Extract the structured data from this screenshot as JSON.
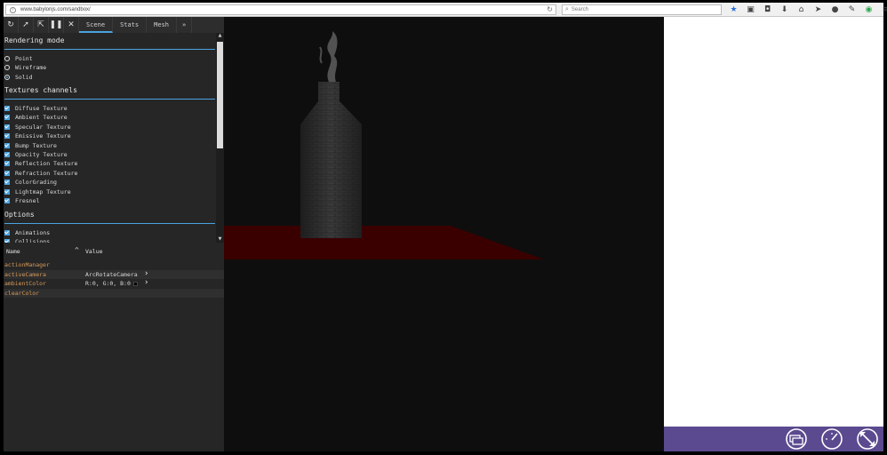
{
  "browser": {
    "url": "www.babylonjs.com/sandbox/",
    "search_placeholder": "Search",
    "toolbar_icons": [
      "star-icon",
      "clipboard-icon",
      "pocket-icon",
      "download-icon",
      "home-icon",
      "send-icon",
      "chat-icon",
      "pen-icon",
      "circle-icon",
      "menu-icon"
    ]
  },
  "inspector": {
    "tool_icons": [
      "refresh-icon",
      "pointer-icon",
      "popout-icon",
      "pause-icon",
      "close-icon"
    ],
    "tabs": [
      {
        "label": "Scene",
        "active": true
      },
      {
        "label": "Stats",
        "active": false
      },
      {
        "label": "Mesh",
        "active": false
      },
      {
        "label": "»",
        "active": false
      }
    ],
    "rendering_mode": {
      "title": "Rendering mode",
      "options": [
        {
          "label": "Point",
          "selected": false
        },
        {
          "label": "Wireframe",
          "selected": false
        },
        {
          "label": "Solid",
          "selected": true
        }
      ]
    },
    "textures": {
      "title": "Textures channels",
      "items": [
        "Diffuse Texture",
        "Ambient Texture",
        "Specular Texture",
        "Emissive Texture",
        "Bump Texture",
        "Opacity Texture",
        "Reflection Texture",
        "Refraction Texture",
        "ColorGrading",
        "Lightmap Texture",
        "Fresnel"
      ]
    },
    "options": {
      "title": "Options",
      "items": [
        "Animations",
        "Collisions"
      ]
    },
    "properties": {
      "name_header": "Name",
      "value_header": "Value",
      "rows": [
        {
          "name": "actionManager",
          "value": "",
          "expandable": false,
          "swatch": false
        },
        {
          "name": "activeCamera",
          "value": "ArcRotateCamera",
          "expandable": true,
          "swatch": false
        },
        {
          "name": "ambientColor",
          "value": "R:0, G:0, B:0",
          "expandable": true,
          "swatch": true
        },
        {
          "name": "clearColor",
          "value": "",
          "expandable": false,
          "swatch": false
        }
      ]
    }
  },
  "scene": {
    "ground_color": "#3a0000",
    "bottle_color": "#2e2e2e",
    "background": "#0e0e0e"
  },
  "accent_colors": {
    "inspector_accent": "#4aa3df",
    "bottom_bar": "#5b4a8f"
  },
  "bottom_bar_icons": [
    "presentation-icon",
    "gauge-icon",
    "fullscreen-icon"
  ]
}
